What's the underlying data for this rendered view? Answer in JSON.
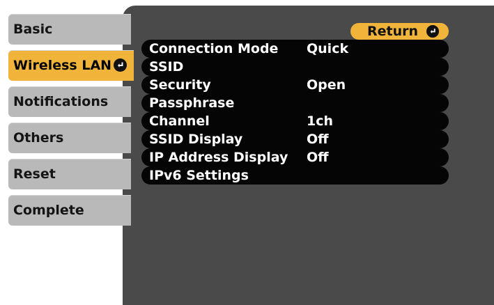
{
  "sidebar": {
    "tabs": [
      {
        "label": "Basic",
        "active": false
      },
      {
        "label": "Wireless LAN",
        "active": true
      },
      {
        "label": "Notifications",
        "active": false
      },
      {
        "label": "Others",
        "active": false
      },
      {
        "label": "Reset",
        "active": false
      },
      {
        "label": "Complete",
        "active": false
      }
    ],
    "active_icon": "enter-icon"
  },
  "panel": {
    "return_label": "Return",
    "return_icon": "enter-icon",
    "rows": [
      {
        "label": "Connection Mode",
        "value": "Quick"
      },
      {
        "label": "SSID",
        "value": ""
      },
      {
        "label": "Security",
        "value": "Open"
      },
      {
        "label": "Passphrase",
        "value": ""
      },
      {
        "label": "Channel",
        "value": "1ch"
      },
      {
        "label": "SSID Display",
        "value": "Off"
      },
      {
        "label": "IP Address Display",
        "value": "Off"
      },
      {
        "label": "IPv6 Settings",
        "value": ""
      }
    ]
  },
  "colors": {
    "accent": "#f0b43a",
    "tab_inactive": "#b9b9b9",
    "panel_bg": "#4a4a4a",
    "row_bg": "#050505",
    "text_light": "#ffffff"
  }
}
